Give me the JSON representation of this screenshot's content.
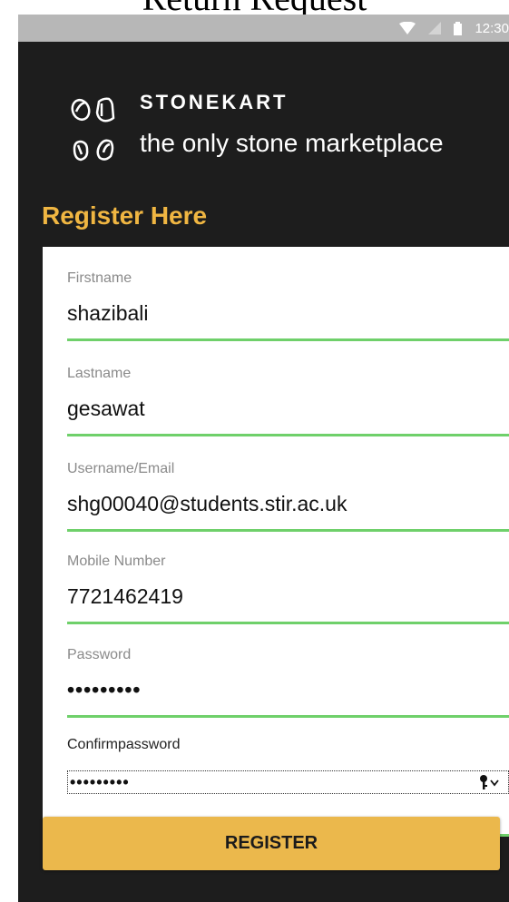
{
  "page_title": "Return Request",
  "status_bar": {
    "time": "12:30",
    "icons": [
      "wifi-icon",
      "signal-icon",
      "battery-icon"
    ]
  },
  "brand": {
    "name": "STONEKART",
    "tagline": "the only stone marketplace"
  },
  "form": {
    "heading": "Register Here",
    "fields": [
      {
        "label": "Firstname",
        "value": "shazibali"
      },
      {
        "label": "Lastname",
        "value": "gesawat"
      },
      {
        "label": "Username/Email",
        "value": "shg00040@students.stir.ac.uk"
      },
      {
        "label": "Mobile Number",
        "value": "7721462419"
      },
      {
        "label": "Password",
        "value": "•••••••••"
      },
      {
        "label": "Confirmpassword",
        "value": "•••••••••"
      }
    ],
    "submit_label": "REGISTER"
  },
  "colors": {
    "accent": "#f0b642",
    "button": "#ebb84c",
    "underline": "#6fd06a",
    "background": "#1d1d1d"
  }
}
